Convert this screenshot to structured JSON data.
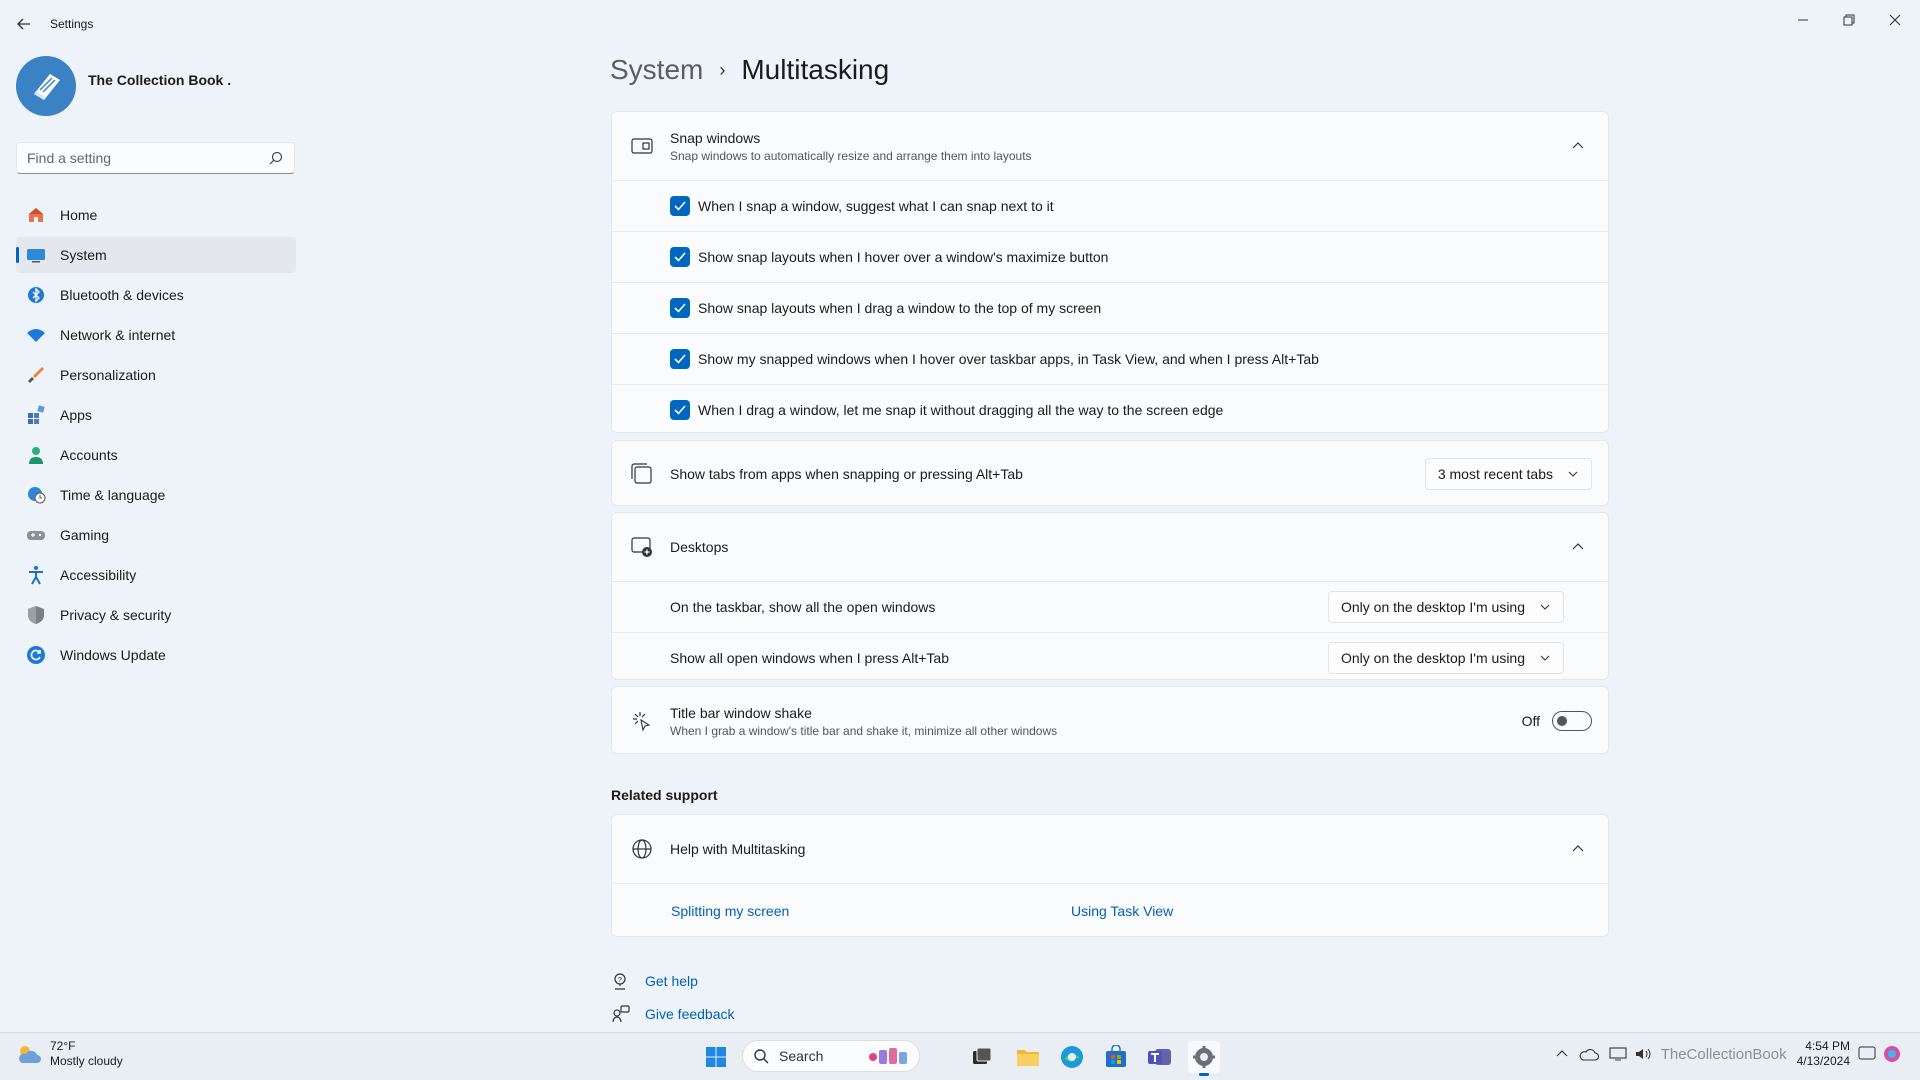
{
  "window": {
    "title": "Settings"
  },
  "profile": {
    "name": "The Collection Book ."
  },
  "search": {
    "placeholder": "Find a setting"
  },
  "sidebar": {
    "items": [
      {
        "label": "Home",
        "icon": "home-icon"
      },
      {
        "label": "System",
        "icon": "monitor-icon",
        "active": true
      },
      {
        "label": "Bluetooth & devices",
        "icon": "bluetooth-icon"
      },
      {
        "label": "Network & internet",
        "icon": "wifi-icon"
      },
      {
        "label": "Personalization",
        "icon": "brush-icon"
      },
      {
        "label": "Apps",
        "icon": "apps-icon"
      },
      {
        "label": "Accounts",
        "icon": "person-icon"
      },
      {
        "label": "Time & language",
        "icon": "globe-clock-icon"
      },
      {
        "label": "Gaming",
        "icon": "gamepad-icon"
      },
      {
        "label": "Accessibility",
        "icon": "accessibility-icon"
      },
      {
        "label": "Privacy & security",
        "icon": "shield-icon"
      },
      {
        "label": "Windows Update",
        "icon": "update-icon"
      }
    ]
  },
  "breadcrumb": {
    "parent": "System",
    "separator": "›",
    "current": "Multitasking"
  },
  "snap": {
    "title": "Snap windows",
    "subtitle": "Snap windows to automatically resize and arrange them into layouts",
    "options": [
      {
        "label": "When I snap a window, suggest what I can snap next to it",
        "checked": true
      },
      {
        "label": "Show snap layouts when I hover over a window's maximize button",
        "checked": true
      },
      {
        "label": "Show snap layouts when I drag a window to the top of my screen",
        "checked": true
      },
      {
        "label": "Show my snapped windows when I hover over taskbar apps, in Task View, and when I press Alt+Tab",
        "checked": true
      },
      {
        "label": "When I drag a window, let me snap it without dragging all the way to the screen edge",
        "checked": true
      }
    ]
  },
  "tabs": {
    "label": "Show tabs from apps when snapping or pressing Alt+Tab",
    "value": "3 most recent tabs"
  },
  "desktops": {
    "title": "Desktops",
    "taskbar_label": "On the taskbar, show all the open windows",
    "taskbar_value": "Only on the desktop I'm using",
    "alttab_label": "Show all open windows when I press Alt+Tab",
    "alttab_value": "Only on the desktop I'm using"
  },
  "shake": {
    "title": "Title bar window shake",
    "subtitle": "When I grab a window's title bar and shake it, minimize all other windows",
    "state": "Off"
  },
  "related": {
    "title": "Related support",
    "help_title": "Help with Multitasking",
    "link1": "Splitting my screen",
    "link2": "Using Task View"
  },
  "footer": {
    "get_help": "Get help",
    "feedback": "Give feedback"
  },
  "taskbar": {
    "weather_temp": "72°F",
    "weather_desc": "Mostly cloudy",
    "search": "Search",
    "time": "4:54 PM",
    "date": "4/13/2024",
    "watermark": "TheCollectionBook"
  },
  "colors": {
    "accent": "#0067c0",
    "background": "#eef3f9",
    "card": "#f9fbfd"
  }
}
